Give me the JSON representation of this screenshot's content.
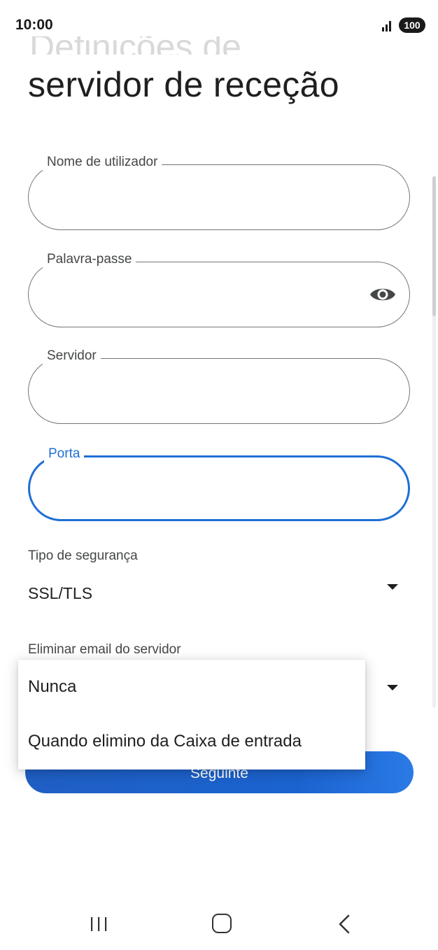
{
  "status_bar": {
    "time": "10:00",
    "battery": "100"
  },
  "page": {
    "title_top": "Definições de",
    "title": "servidor de receção"
  },
  "form": {
    "username": {
      "label": "Nome de utilizador",
      "value": ""
    },
    "password": {
      "label": "Palavra-passe",
      "value": ""
    },
    "server": {
      "label": "Servidor",
      "value": ""
    },
    "port": {
      "label": "Porta",
      "value": ""
    }
  },
  "security": {
    "label": "Tipo de segurança",
    "selected": "SSL/TLS"
  },
  "delete_email": {
    "label": "Eliminar email do servidor",
    "options": [
      "Nunca",
      "Quando elimino da Caixa de entrada"
    ]
  },
  "buttons": {
    "next": "Seguinte"
  },
  "colors": {
    "accent": "#1f6fd6",
    "outline": "#747775",
    "button": "#1b63d0"
  },
  "icons": {
    "password_toggle": "eye-icon",
    "nav": [
      "recent-apps-icon",
      "home-icon",
      "back-icon"
    ]
  }
}
